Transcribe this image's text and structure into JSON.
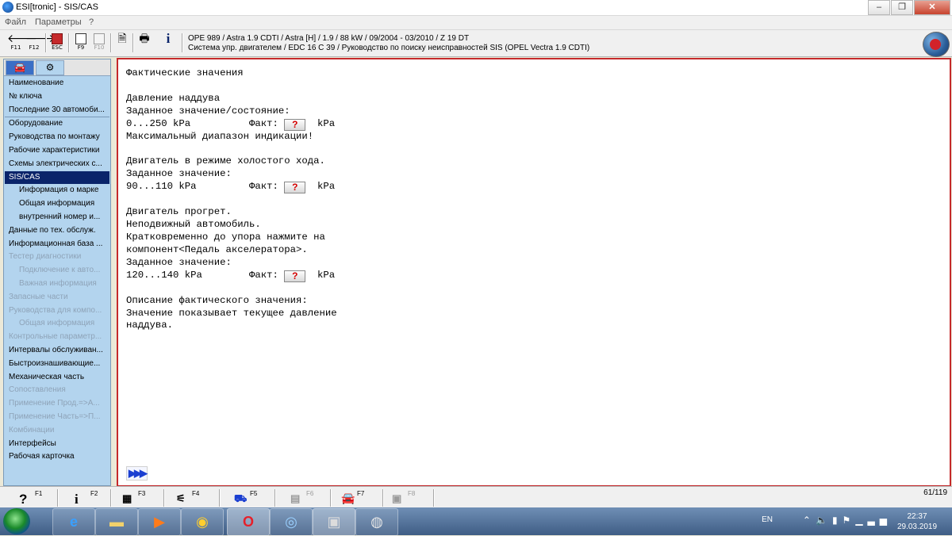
{
  "window": {
    "title": "ESI[tronic] - SIS/CAS"
  },
  "menu": {
    "file": "Файл",
    "params": "Параметры",
    "help": "?"
  },
  "toolbar": {
    "buttons": [
      {
        "key": "F11",
        "icon": "arrow-left-icon"
      },
      {
        "key": "F12",
        "icon": "arrow-right-icon"
      },
      {
        "key": "ESC",
        "icon": "exit-icon"
      },
      {
        "key": "F9",
        "icon": "document-icon"
      },
      {
        "key": "F10",
        "icon": "compare-icon"
      }
    ],
    "vehicle_line": "OPE 989 / Astra 1.9 CDTI / Astra [H] / 1.9 / 88 kW / 09/2004 - 03/2010 / Z 19 DT",
    "system_line": "Система упр. двигателем / EDC 16 C 39 / Руководство по поиску неисправностей SIS (OPEL Vectra 1.9 CDTI)"
  },
  "sidebar": {
    "items": [
      {
        "label": "Наименование",
        "state": "normal"
      },
      {
        "label": "№ ключа",
        "state": "normal"
      },
      {
        "label": "Последние 30 автомоби...",
        "state": "normal"
      },
      {
        "label": "Оборудование",
        "state": "normal",
        "gap": true
      },
      {
        "label": "Руководства по монтажу",
        "state": "normal"
      },
      {
        "label": "Рабочие характеристики",
        "state": "normal"
      },
      {
        "label": "Схемы электрических с...",
        "state": "normal"
      },
      {
        "label": "SIS/CAS",
        "state": "selected"
      },
      {
        "label": "Информация о марке",
        "state": "normal",
        "sub": true
      },
      {
        "label": "Общая информация",
        "state": "normal",
        "sub": true
      },
      {
        "label": "внутренний номер и...",
        "state": "normal",
        "sub": true
      },
      {
        "label": "Данные по тех. обслуж.",
        "state": "normal"
      },
      {
        "label": "Информационная база ...",
        "state": "normal"
      },
      {
        "label": "Тестер диагностики",
        "state": "disabled"
      },
      {
        "label": "Подключение к авто...",
        "state": "disabled",
        "sub": true
      },
      {
        "label": "Важная информация",
        "state": "disabled",
        "sub": true
      },
      {
        "label": "Запасные части",
        "state": "disabled"
      },
      {
        "label": "Руководства для компо...",
        "state": "disabled"
      },
      {
        "label": "Общая информация",
        "state": "disabled",
        "sub": true
      },
      {
        "label": "Контрольные параметр...",
        "state": "disabled"
      },
      {
        "label": "Интервалы обслуживан...",
        "state": "normal"
      },
      {
        "label": "Быстроизнашивающие...",
        "state": "normal"
      },
      {
        "label": "Механическая часть",
        "state": "normal"
      },
      {
        "label": "Сопоставления",
        "state": "disabled"
      },
      {
        "label": "Применение Прод.=>А...",
        "state": "disabled"
      },
      {
        "label": "Применение Часть=>П...",
        "state": "disabled"
      },
      {
        "label": "Комбинации",
        "state": "disabled"
      },
      {
        "label": "Интерфейсы",
        "state": "normal"
      },
      {
        "label": "Рабочая карточка",
        "state": "normal"
      }
    ]
  },
  "doc": {
    "l1": "Фактические значения",
    "l2": "Давление наддува",
    "l3": "Заданное значение/состояние:",
    "l4a": "0...250 kPa",
    "fact": "Факт:",
    "unit": "kPa",
    "qmark": "?",
    "l5": "Максимальный диапазон индикации!",
    "l6": "Двигатель в режиме холостого хода.",
    "l7": "Заданное значение:",
    "l8a": "90...110 kPa",
    "l9": "Двигатель прогрет.",
    "l10": "Неподвижный автомобиль.",
    "l11": "Кратковременно до упора нажмите на",
    "l12": "компонент<Педаль акселератора>.",
    "l13": "Заданное значение:",
    "l14a": "120...140 kPa",
    "l15": "Описание фактического значения:",
    "l16": "Значение показывает текущее давление",
    "l17": "наддува.",
    "more": "▶▶▶"
  },
  "status": {
    "keys": [
      "F1",
      "F2",
      "F3",
      "F4",
      "F5",
      "F6",
      "F7",
      "F8"
    ],
    "page": "61/119"
  },
  "tray": {
    "lang": "EN",
    "time": "22:37",
    "date": "29.03.2019"
  }
}
